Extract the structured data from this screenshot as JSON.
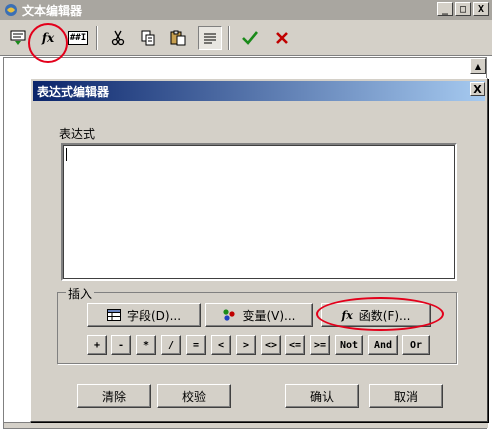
{
  "outer_window": {
    "title": "文本编辑器",
    "min_label": "_",
    "max_label": "□",
    "close_label": "X"
  },
  "toolbar": {
    "icons": [
      "insert-field-icon",
      "fx-icon",
      "format-icon",
      "cut-icon",
      "copy-icon",
      "paste-icon",
      "align-icon",
      "checkmark-icon",
      "x-icon"
    ],
    "fx_label": "fx",
    "format_label": "##I"
  },
  "dialog": {
    "title": "表达式编辑器",
    "close_label": "X",
    "expression_label": "表达式",
    "expression_value": "",
    "insert_group_label": "插入",
    "field_button": "字段(D)...",
    "variable_button": "变量(V)...",
    "function_button": "函数(F)...",
    "function_icon_label": "fx",
    "operators": [
      "+",
      "-",
      "*",
      "/",
      "=",
      "<",
      ">",
      "<>",
      "<=",
      ">=",
      "Not",
      "And",
      "Or"
    ],
    "clear_button": "清除",
    "verify_button": "校验",
    "ok_button": "确认",
    "cancel_button": "取消"
  },
  "colors": {
    "annotation_red": "#e3001b",
    "dialog_title_start": "#0a246a",
    "dialog_title_end": "#a6caf0",
    "face": "#d4d0c8"
  }
}
